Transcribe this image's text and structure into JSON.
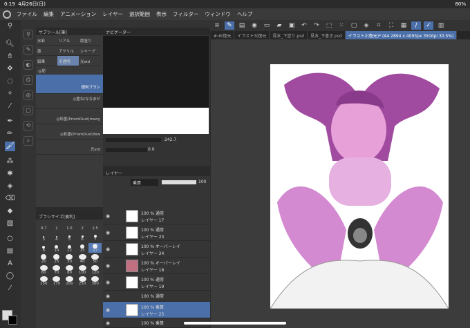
{
  "status": {
    "time": "0:19",
    "date": "4月26日(日)",
    "battery": "80%"
  },
  "menu": [
    "ファイル",
    "編集",
    "アニメーション",
    "レイヤー",
    "選択範囲",
    "表示",
    "フィルター",
    "ウィンドウ",
    "ヘルプ"
  ],
  "doc_tabs": [
    "#-6(復元",
    "イラスト3(復元",
    "見本_下塗り.psd",
    "見本_下書き.psd",
    "イラスト2(復元)* (A4 2894 x 4093px 350dpi 30.5%)"
  ],
  "subtool": {
    "title": "サブツール[筆]",
    "tabs": [
      "水彩",
      "リアル",
      "厚塗り",
      "墨",
      "アクリル",
      "シャープ",
      "鉛筆",
      "不透明",
      "光std"
    ],
    "extra": "◎彩",
    "brushes": [
      "便利ブラシ",
      "◎重ね/ななませ",
      "◎彩墨(PrismDust)many",
      "◎彩墨(PrismDust)few",
      "光std"
    ]
  },
  "navigator": {
    "title": "ナビゲーター",
    "zoom": "242.7",
    "rotate": "0.0"
  },
  "layer_panel": {
    "title": "レイヤー",
    "blend": "乗算",
    "opacity": "100"
  },
  "layers": [
    {
      "mode": "100 % 通常",
      "name": "レイヤー 17",
      "thumb": "#ffffff"
    },
    {
      "mode": "100 % 通常",
      "name": "レイヤー 23",
      "thumb": "#ffffff"
    },
    {
      "mode": "100 % オーバーレイ",
      "name": "レイヤー 24",
      "thumb": "#ffffff"
    },
    {
      "mode": "100 % オーバーレイ",
      "name": "レイヤー 18",
      "thumb": "#c07080"
    },
    {
      "mode": "100 % 通常",
      "name": "レイヤー 19",
      "thumb": "#ffffff"
    },
    {
      "mode": "100 % 通常",
      "name": "",
      "thumb": "#ffffff"
    },
    {
      "mode": "100 % 乗算",
      "name": "レイヤー 25",
      "thumb": "#ffffff"
    },
    {
      "mode": "100 % 乗算",
      "name": "",
      "thumb": "#ffffff"
    }
  ],
  "brush_size": {
    "title": "ブラシサイズ[便利]",
    "sizes": [
      "0.7",
      "1",
      "1.5",
      "2",
      "2.5",
      "3",
      "4",
      "5",
      "6",
      "7",
      "8",
      "10",
      "12",
      "15",
      "17",
      "20",
      "25",
      "30",
      "40",
      "50",
      "60",
      "70",
      "80",
      "100",
      "120",
      "150",
      "170",
      "200",
      "250",
      "300"
    ]
  }
}
